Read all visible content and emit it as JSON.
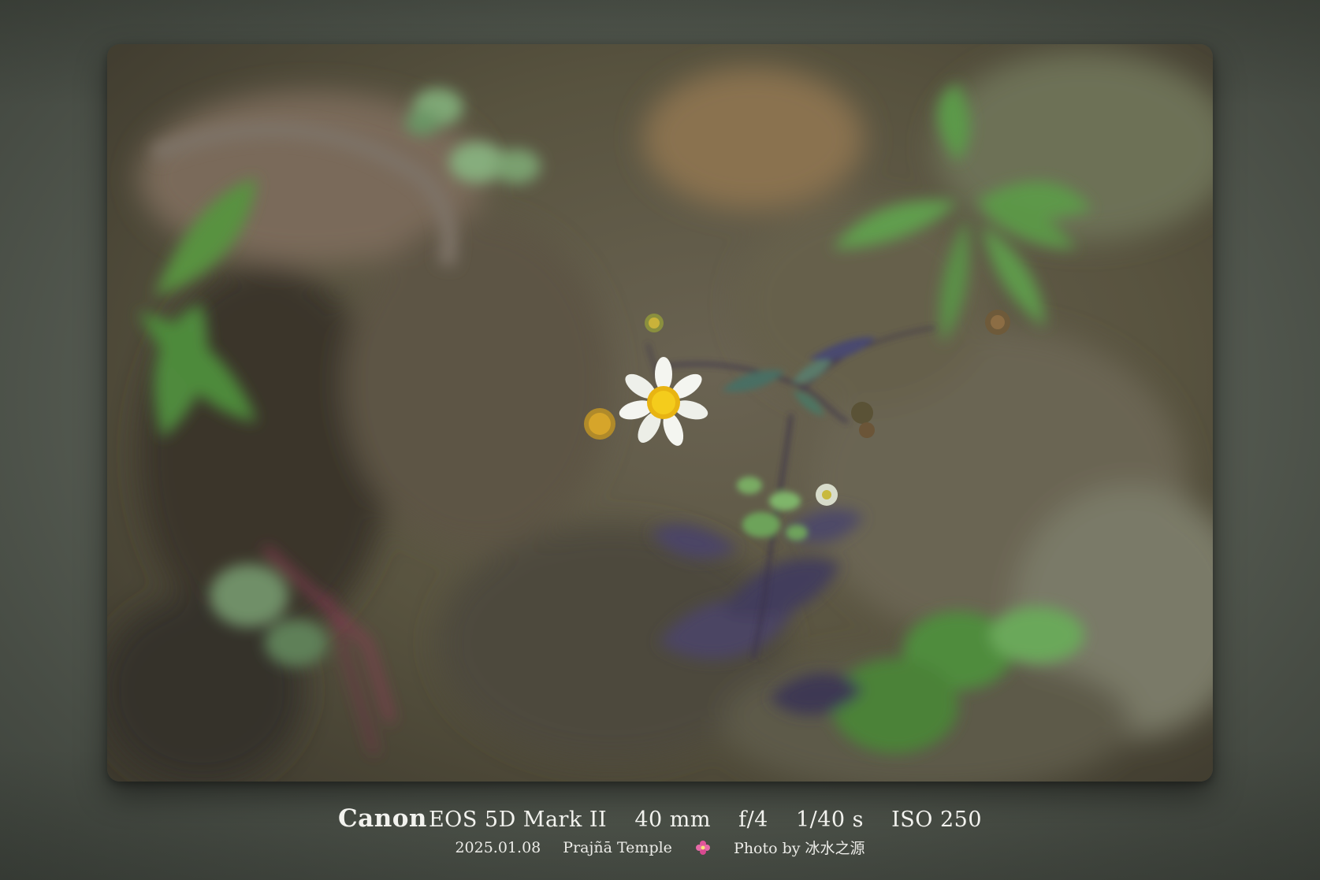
{
  "camera": {
    "brand": "Canon",
    "model": "EOS 5D Mark II",
    "focal_length": "40 mm",
    "aperture": "f/4",
    "shutter": "1/40 s",
    "iso": "ISO 250"
  },
  "details": {
    "date": "2025.01.08",
    "location": "Prajñā Temple",
    "separator_icon": "flower-icon",
    "credit": "Photo by 冰水之源"
  },
  "colors": {
    "background": "#5b6157",
    "caption_text": "#f2f2ee",
    "separator_icon": "#e0559a"
  }
}
